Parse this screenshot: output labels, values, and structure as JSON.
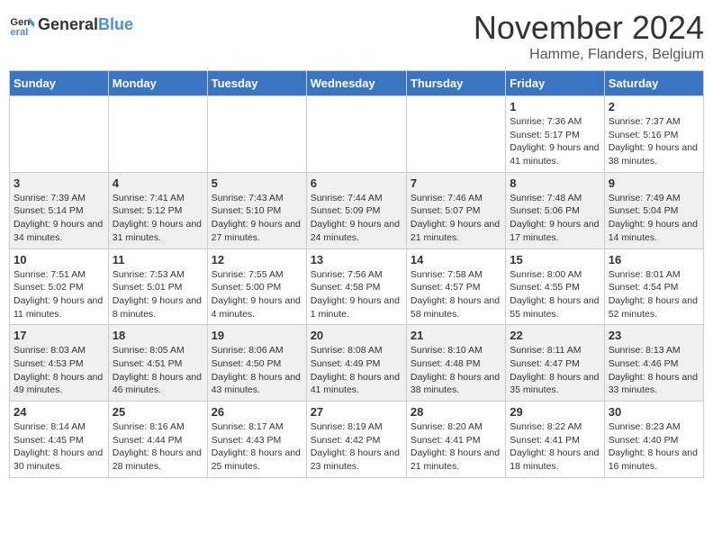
{
  "logo": {
    "text_general": "General",
    "text_blue": "Blue"
  },
  "title": "November 2024",
  "location": "Hamme, Flanders, Belgium",
  "days_header": [
    "Sunday",
    "Monday",
    "Tuesday",
    "Wednesday",
    "Thursday",
    "Friday",
    "Saturday"
  ],
  "weeks": [
    {
      "days": [
        {
          "num": "",
          "info": ""
        },
        {
          "num": "",
          "info": ""
        },
        {
          "num": "",
          "info": ""
        },
        {
          "num": "",
          "info": ""
        },
        {
          "num": "",
          "info": ""
        },
        {
          "num": "1",
          "info": "Sunrise: 7:36 AM\nSunset: 5:17 PM\nDaylight: 9 hours and 41 minutes."
        },
        {
          "num": "2",
          "info": "Sunrise: 7:37 AM\nSunset: 5:16 PM\nDaylight: 9 hours and 38 minutes."
        }
      ]
    },
    {
      "days": [
        {
          "num": "3",
          "info": "Sunrise: 7:39 AM\nSunset: 5:14 PM\nDaylight: 9 hours and 34 minutes."
        },
        {
          "num": "4",
          "info": "Sunrise: 7:41 AM\nSunset: 5:12 PM\nDaylight: 9 hours and 31 minutes."
        },
        {
          "num": "5",
          "info": "Sunrise: 7:43 AM\nSunset: 5:10 PM\nDaylight: 9 hours and 27 minutes."
        },
        {
          "num": "6",
          "info": "Sunrise: 7:44 AM\nSunset: 5:09 PM\nDaylight: 9 hours and 24 minutes."
        },
        {
          "num": "7",
          "info": "Sunrise: 7:46 AM\nSunset: 5:07 PM\nDaylight: 9 hours and 21 minutes."
        },
        {
          "num": "8",
          "info": "Sunrise: 7:48 AM\nSunset: 5:06 PM\nDaylight: 9 hours and 17 minutes."
        },
        {
          "num": "9",
          "info": "Sunrise: 7:49 AM\nSunset: 5:04 PM\nDaylight: 9 hours and 14 minutes."
        }
      ]
    },
    {
      "days": [
        {
          "num": "10",
          "info": "Sunrise: 7:51 AM\nSunset: 5:02 PM\nDaylight: 9 hours and 11 minutes."
        },
        {
          "num": "11",
          "info": "Sunrise: 7:53 AM\nSunset: 5:01 PM\nDaylight: 9 hours and 8 minutes."
        },
        {
          "num": "12",
          "info": "Sunrise: 7:55 AM\nSunset: 5:00 PM\nDaylight: 9 hours and 4 minutes."
        },
        {
          "num": "13",
          "info": "Sunrise: 7:56 AM\nSunset: 4:58 PM\nDaylight: 9 hours and 1 minute."
        },
        {
          "num": "14",
          "info": "Sunrise: 7:58 AM\nSunset: 4:57 PM\nDaylight: 8 hours and 58 minutes."
        },
        {
          "num": "15",
          "info": "Sunrise: 8:00 AM\nSunset: 4:55 PM\nDaylight: 8 hours and 55 minutes."
        },
        {
          "num": "16",
          "info": "Sunrise: 8:01 AM\nSunset: 4:54 PM\nDaylight: 8 hours and 52 minutes."
        }
      ]
    },
    {
      "days": [
        {
          "num": "17",
          "info": "Sunrise: 8:03 AM\nSunset: 4:53 PM\nDaylight: 8 hours and 49 minutes."
        },
        {
          "num": "18",
          "info": "Sunrise: 8:05 AM\nSunset: 4:51 PM\nDaylight: 8 hours and 46 minutes."
        },
        {
          "num": "19",
          "info": "Sunrise: 8:06 AM\nSunset: 4:50 PM\nDaylight: 8 hours and 43 minutes."
        },
        {
          "num": "20",
          "info": "Sunrise: 8:08 AM\nSunset: 4:49 PM\nDaylight: 8 hours and 41 minutes."
        },
        {
          "num": "21",
          "info": "Sunrise: 8:10 AM\nSunset: 4:48 PM\nDaylight: 8 hours and 38 minutes."
        },
        {
          "num": "22",
          "info": "Sunrise: 8:11 AM\nSunset: 4:47 PM\nDaylight: 8 hours and 35 minutes."
        },
        {
          "num": "23",
          "info": "Sunrise: 8:13 AM\nSunset: 4:46 PM\nDaylight: 8 hours and 33 minutes."
        }
      ]
    },
    {
      "days": [
        {
          "num": "24",
          "info": "Sunrise: 8:14 AM\nSunset: 4:45 PM\nDaylight: 8 hours and 30 minutes."
        },
        {
          "num": "25",
          "info": "Sunrise: 8:16 AM\nSunset: 4:44 PM\nDaylight: 8 hours and 28 minutes."
        },
        {
          "num": "26",
          "info": "Sunrise: 8:17 AM\nSunset: 4:43 PM\nDaylight: 8 hours and 25 minutes."
        },
        {
          "num": "27",
          "info": "Sunrise: 8:19 AM\nSunset: 4:42 PM\nDaylight: 8 hours and 23 minutes."
        },
        {
          "num": "28",
          "info": "Sunrise: 8:20 AM\nSunset: 4:41 PM\nDaylight: 8 hours and 21 minutes."
        },
        {
          "num": "29",
          "info": "Sunrise: 8:22 AM\nSunset: 4:41 PM\nDaylight: 8 hours and 18 minutes."
        },
        {
          "num": "30",
          "info": "Sunrise: 8:23 AM\nSunset: 4:40 PM\nDaylight: 8 hours and 16 minutes."
        }
      ]
    }
  ]
}
